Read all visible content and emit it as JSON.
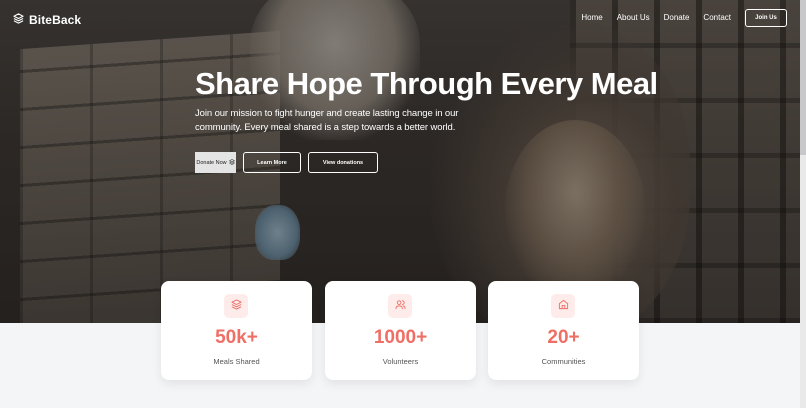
{
  "brand": {
    "name": "BiteBack",
    "icon": "layers-icon"
  },
  "nav": {
    "links": [
      "Home",
      "About Us",
      "Donate",
      "Contact"
    ],
    "join_label": "Join Us"
  },
  "hero": {
    "headline": "Share Hope Through Every Meal",
    "subtext": "Join our mission to fight hunger and create lasting change in our community. Every meal shared is a step towards a better world.",
    "buttons": {
      "donate_label": "Donate Now",
      "learn_label": "Learn More",
      "view_label": "View donations"
    }
  },
  "stats": [
    {
      "value": "50k+",
      "label": "Meals Shared",
      "icon": "layers-icon"
    },
    {
      "value": "1000+",
      "label": "Volunteers",
      "icon": "users-icon"
    },
    {
      "value": "20+",
      "label": "Communities",
      "icon": "home-icon"
    }
  ],
  "colors": {
    "accent": "#ef6f66",
    "icon_bg": "#fdecea"
  }
}
